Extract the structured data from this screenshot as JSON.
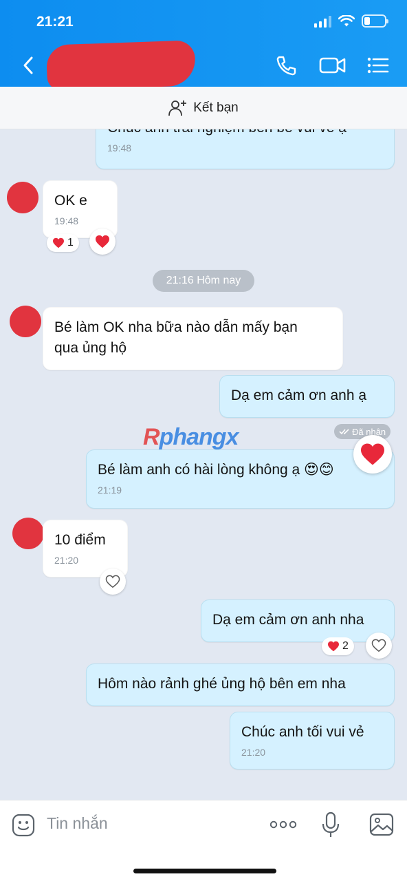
{
  "status": {
    "time": "21:21"
  },
  "header": {
    "back_icon": "chevron-left-icon",
    "icons": [
      "phone-icon",
      "video-camera-icon",
      "menu-list-icon"
    ]
  },
  "friend_bar": {
    "label": "Kết bạn",
    "icon": "add-user-icon"
  },
  "messages": [
    {
      "side": "me",
      "text": "Chúc anh trải nghiệm bên bé vui vẻ ạ",
      "time": "19:48"
    },
    {
      "side": "them",
      "text": "OK e",
      "time": "19:48",
      "reaction": {
        "icon": "heart",
        "count": "1"
      }
    },
    {
      "side": "them",
      "text": "Bé làm OK nha bữa nào dẫn mấy bạn\nqua ủng hộ"
    },
    {
      "side": "me",
      "text": "Dạ em cảm ơn anh ạ"
    },
    {
      "side": "me",
      "text": "Bé làm anh có hài lòng không ạ 😍😊",
      "time": "21:19"
    },
    {
      "side": "them",
      "text": "10 điểm",
      "time": "21:20"
    },
    {
      "side": "me",
      "text": "Dạ em cảm ơn anh nha",
      "reaction": {
        "icon": "heart",
        "count": "2"
      }
    },
    {
      "side": "me",
      "text": "Hôm nào rảnh ghé ủng hộ bên em nha"
    },
    {
      "side": "me",
      "text": "Chúc anh tối vui vẻ",
      "time": "21:20"
    }
  ],
  "date_separator": "21:16 Hôm nay",
  "seen_status": "Đã nhận",
  "watermark": {
    "prefix": "R",
    "rest": "phangx"
  },
  "input": {
    "placeholder": "Tin nhắn",
    "icons": [
      "emoji-icon",
      "more-icon",
      "microphone-icon",
      "image-icon"
    ]
  },
  "colors": {
    "header": "#1a9cf4",
    "my_bubble": "#d5f1ff",
    "their_bubble": "#ffffff",
    "background": "#e2e8f2",
    "heart": "#e8283a"
  }
}
